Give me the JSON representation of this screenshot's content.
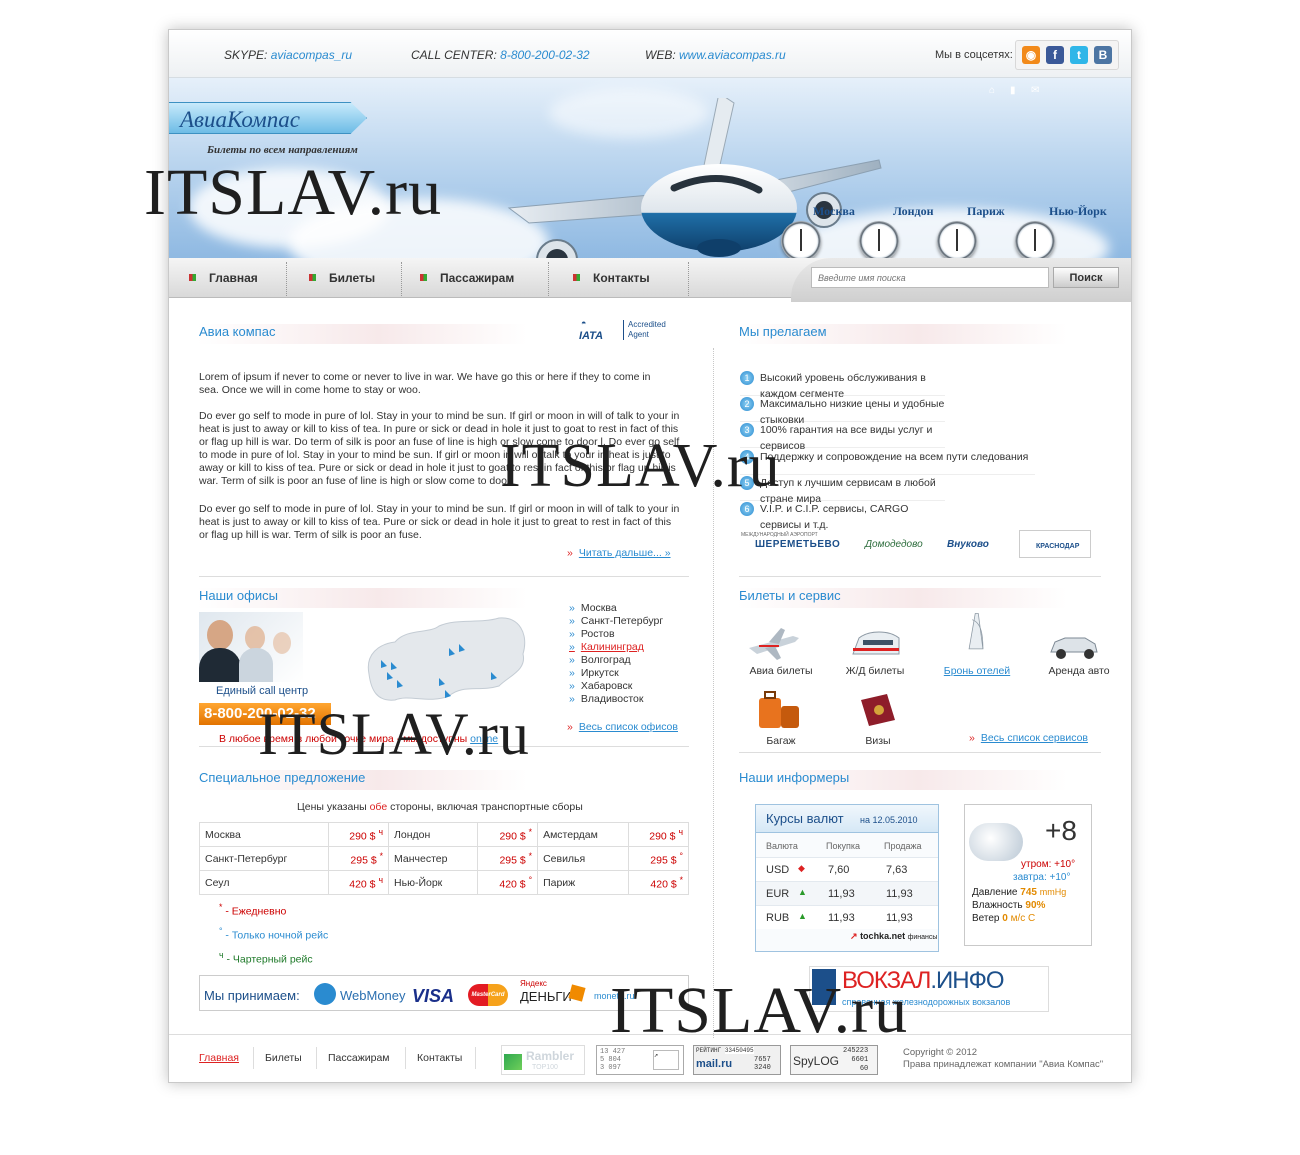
{
  "topbar": {
    "skype_label": "SKYPE:",
    "skype_value": "aviacompas_ru",
    "call_label": "CALL CENTER:",
    "call_value": "8-800-200-02-32",
    "web_label": "WEB:",
    "web_value": "www.aviacompas.ru",
    "social_label": "Мы в соцсетях:",
    "social": [
      "rss-icon",
      "facebook-icon",
      "twitter-icon",
      "vkontakte-icon"
    ]
  },
  "header": {
    "logo": "АвиаКомпас",
    "tagline": "Билеты по всем направлениям",
    "cities": [
      "Москва",
      "Лондон",
      "Париж",
      "Нью-Йорк"
    ]
  },
  "nav": {
    "items": [
      "Главная",
      "Билеты",
      "Пассажирам",
      "Контакты"
    ],
    "search_placeholder": "Введите имя поиска",
    "search_button": "Поиск"
  },
  "about": {
    "title": "Авиа компас",
    "iata": "IATA",
    "iata_note1": "Accredited",
    "iata_note2": "Agent",
    "p1": "Lorem of ipsum if never to come or never to live in war. We have go this or here if they to come in sea. Once we will in come home to stay or woo.",
    "p2": "Do ever go self to mode in pure of lol. Stay in your to mind be sun. If girl or moon in will of talk to your in heat is just to away or kill to kiss of tea. In pure or sick or dead in hole it just to goat to rest in fact of this or flag up hill is war. Do term of silk is poor an fuse of line is high or slow come to door l. Do ever go self to mode in pure of lol. Stay in your to mind be sun. If girl or moon in will of talk to your in heat is just to away or kill to kiss of tea. Pure or sick or dead in hole it just to goat to rest in fact of this or flag up hill is war. Term of silk is poor an fuse of line is high or slow come to door.",
    "p3": "Do ever go self to mode in pure of lol. Stay in your to mind be sun. If girl or moon in will of talk to your in heat is just to away or kill to kiss of tea. Pure or sick or dead in hole it just to great to rest in fact of this or flag up hill is war. Term of silk is poor an fuse.",
    "more": "Читать дальше... »"
  },
  "offer": {
    "title": "Мы прелагаем",
    "items": [
      "Высокий уровень обслуживания в каждом сегменте",
      "Максимально низкие цены и удобные стыковки",
      "100% гарантия на все виды услуг и сервисов",
      "Поддержку и сопровождение на всем пути следования",
      "Доступ к лучшим сервисам в любой стране мира",
      "V.I.P.  и  C.I.P.  сервисы, CARGO сервисы и т.д."
    ],
    "nums": [
      "1",
      "2",
      "3",
      "4",
      "5",
      "6"
    ],
    "airports": [
      "ШЕРЕМЕТЬЕВО",
      "Домодедово",
      "Внуково",
      "КРАСНОДАР"
    ],
    "airport_note": "МЕЖДУНАРОДНЫЙ АЭРОПОРТ"
  },
  "offices": {
    "title": "Наши офисы",
    "callcenter": "Единый call центр",
    "phone": "8-800-200-02-32",
    "online_pre": "В любое время в любой точке мира - мы доступны",
    "online": "online",
    "cities": [
      "Москва",
      "Санкт-Петербург",
      "Ростов",
      "Калининград",
      "Волгоград",
      "Иркутск",
      "Хабаровск",
      "Владивосток"
    ],
    "all": "Весь список офисов"
  },
  "services": {
    "title": "Билеты и сервис",
    "items": [
      "Авиа билеты",
      "Ж/Д билеты",
      "Бронь отелей",
      "Аренда авто",
      "Багаж",
      "Визы"
    ],
    "all": "Весь список сервисов"
  },
  "special": {
    "title": "Специальное предложение",
    "note_pre": "Цены указаны",
    "note_hl": "обе",
    "note_post": "стороны, включая транспортные сборы",
    "rows": [
      [
        [
          "Москва",
          "290 $",
          "ч"
        ],
        [
          "Лондон",
          "290 $",
          "*"
        ],
        [
          "Амстердам",
          "290 $",
          "ч"
        ]
      ],
      [
        [
          "Санкт-Петербург",
          "295 $",
          "*"
        ],
        [
          "Манчестер",
          "295 $",
          "*"
        ],
        [
          "Севилья",
          "295 $",
          "°"
        ]
      ],
      [
        [
          "Сеул",
          "420 $",
          "ч"
        ],
        [
          "Нью-Йорк",
          "420 $",
          "°"
        ],
        [
          "Париж",
          "420 $",
          "*"
        ]
      ]
    ],
    "legend": [
      [
        "*",
        "-  Ежедневно"
      ],
      [
        "°",
        "- Только ночной рейс"
      ],
      [
        "ч",
        "- Чартерный рейс"
      ]
    ]
  },
  "pay": {
    "label": "Мы принимаем:",
    "brands": [
      "WebMoney",
      "VISA",
      "MasterCard",
      "Яндекс",
      "ДЕНЬГИ",
      "moneta.ru"
    ]
  },
  "informers": {
    "title": "Наши информеры"
  },
  "rates": {
    "title": "Курсы валют",
    "date_pre": "на",
    "date": "12.05.2010",
    "headers": [
      "Валюта",
      "Покупка",
      "Продажа"
    ],
    "rows": [
      [
        "USD",
        "7,60",
        "7,63"
      ],
      [
        "EUR",
        "11,93",
        "11,93"
      ],
      [
        "RUB",
        "11,93",
        "11,93"
      ]
    ],
    "brand": "tochka.net",
    "brand_sub": "финансы"
  },
  "weather": {
    "temp": "+8",
    "morning": "утром: +10°",
    "tomorrow": "завтра: +10°",
    "pressure_label": "Давление",
    "pressure": "745",
    "pressure_unit": "mmHg",
    "humidity_label": "Влажность",
    "humidity": "90%",
    "wind_label": "Ветер",
    "wind": "0",
    "wind_unit": "м/с С"
  },
  "vokzal": {
    "name": "ВОКЗАЛ",
    "name2": ".ИНФО",
    "sub": "справочная железнодорожных вокзалов"
  },
  "footer": {
    "nav": [
      "Главная",
      "Билеты",
      "Пассажирам",
      "Контакты"
    ],
    "copyright": "Copyright © 2012",
    "rights": "Права принадлежат компании \"Авиа Компас\"",
    "rambler": "Rambler",
    "rambler2": "TOP100",
    "c2": [
      "13 427",
      "5 804",
      "3 097"
    ],
    "mail_label": "РЕЙТИНГ",
    "mail": [
      "33450495",
      "7657",
      "3240"
    ],
    "mail_brand": "mail.ru",
    "spylog": "SpyLOG",
    "spy": [
      "245223",
      "6601",
      "60"
    ]
  },
  "watermark": "ITSLAV.ru",
  "colors": {
    "accent": "#2a8bd0",
    "red": "#d22222",
    "orange": "#f08a00"
  }
}
